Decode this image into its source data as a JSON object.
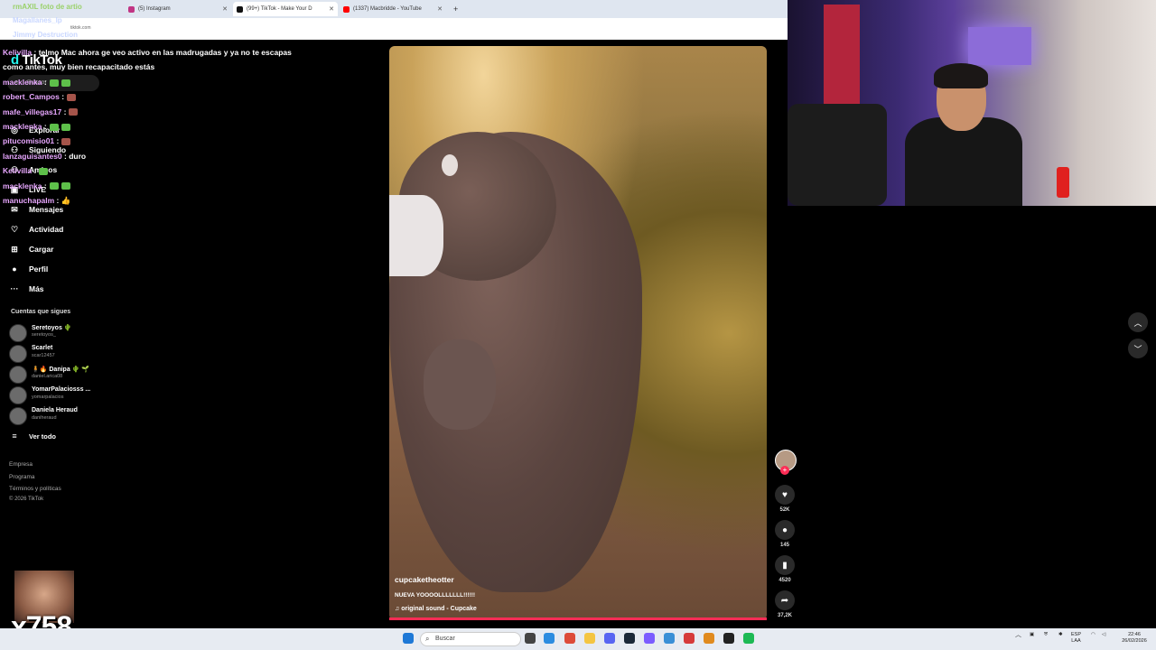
{
  "browser": {
    "tabs": [
      {
        "label": "(5) Instagram",
        "color": "#c13584"
      },
      {
        "label": "(99+) TikTok - Make Your D",
        "color": "#111111",
        "active": true
      },
      {
        "label": "(1337) Macbridde - YouTube",
        "color": "#ff0000"
      }
    ],
    "url_fragment": "tiktok.com"
  },
  "overlay_top": {
    "line1": "rmAXIL foto de artio",
    "line2": "Magallanes_lp",
    "line3": "Jimmy Destruction"
  },
  "chat": [
    {
      "name": "Kelivilla",
      "text": " : telmo Mac ahora ge veo activo en las madrugadas y ya no te escapas como antes, muy bien recapacitado estás"
    },
    {
      "name": "macklenka",
      "text": " :",
      "emotes": 2
    },
    {
      "name": "robert_Campos",
      "text": " :",
      "emotes": 1,
      "red": true
    },
    {
      "name": "mafe_villegas17",
      "text": " :",
      "emotes": 1,
      "red": true
    },
    {
      "name": "macklenka",
      "text": " :",
      "emotes": 2
    },
    {
      "name": "pitucomisio01",
      "text": " :",
      "emotes": 1,
      "red": true
    },
    {
      "name": "lanzaguisantes0",
      "text": " : duro"
    },
    {
      "name": "Kelivilla",
      "text": " :",
      "emotes": 1
    },
    {
      "name": "macklenka",
      "text": " :",
      "emotes": 2
    },
    {
      "name": "manuchapalm",
      "text": " : 👍"
    }
  ],
  "tiktok": {
    "logo": "TikTok",
    "search_placeholder": "Buscar",
    "nav": [
      {
        "label": "Explorar",
        "icon": "compass-icon",
        "glyph": "◎"
      },
      {
        "label": "Siguiendo",
        "icon": "following-icon",
        "glyph": "⚇"
      },
      {
        "label": "Amigos",
        "icon": "friends-icon",
        "glyph": "⚇"
      },
      {
        "label": "LIVE",
        "icon": "live-icon",
        "glyph": "▣"
      },
      {
        "label": "Mensajes",
        "icon": "messages-icon",
        "glyph": "✉"
      },
      {
        "label": "Actividad",
        "icon": "activity-icon",
        "glyph": "♡"
      },
      {
        "label": "Cargar",
        "icon": "upload-icon",
        "glyph": "⊞"
      },
      {
        "label": "Perfil",
        "icon": "profile-icon",
        "glyph": "●"
      },
      {
        "label": "Más",
        "icon": "more-icon",
        "glyph": "···"
      }
    ],
    "following_title": "Cuentas que sigues",
    "following": [
      {
        "name": "Seretoyos 🌵",
        "handle": "seretoyos_"
      },
      {
        "name": "Scarlet",
        "handle": "scar12457"
      },
      {
        "name": "🧍🔥 Danipa 🌵 🌱",
        "handle": "daniel.arica08"
      },
      {
        "name": "YomarPalaciosss ...",
        "handle": "yomarpalacios"
      },
      {
        "name": "Daniela Heraud",
        "handle": "daniheraud"
      }
    ],
    "see_all": "Ver todo",
    "footer": [
      "Empresa",
      "Programa",
      "Términos y políticas",
      "© 2026 TikTok"
    ]
  },
  "video": {
    "username": "cupcaketheotter",
    "caption": "NUEVA YOOOOLLLLLLL!!!!!!",
    "sound": "♫ original sound - Cupcake",
    "progress": 1.0,
    "actions": [
      {
        "icon": "heart-icon",
        "glyph": "♥",
        "count": "52K"
      },
      {
        "icon": "comment-icon",
        "glyph": "●",
        "count": "145"
      },
      {
        "icon": "bookmark-icon",
        "glyph": "▮",
        "count": "4520"
      },
      {
        "icon": "share-icon",
        "glyph": "➦",
        "count": "37,2K"
      }
    ]
  },
  "overlay_counter": "x758",
  "taskbar": {
    "search": "Buscar",
    "lang": "ESP\nLAA",
    "time": "22:46",
    "date": "26/02/2026"
  },
  "colors": {
    "accent": "#fe2c55",
    "chat_name": "#e8a7ff"
  }
}
